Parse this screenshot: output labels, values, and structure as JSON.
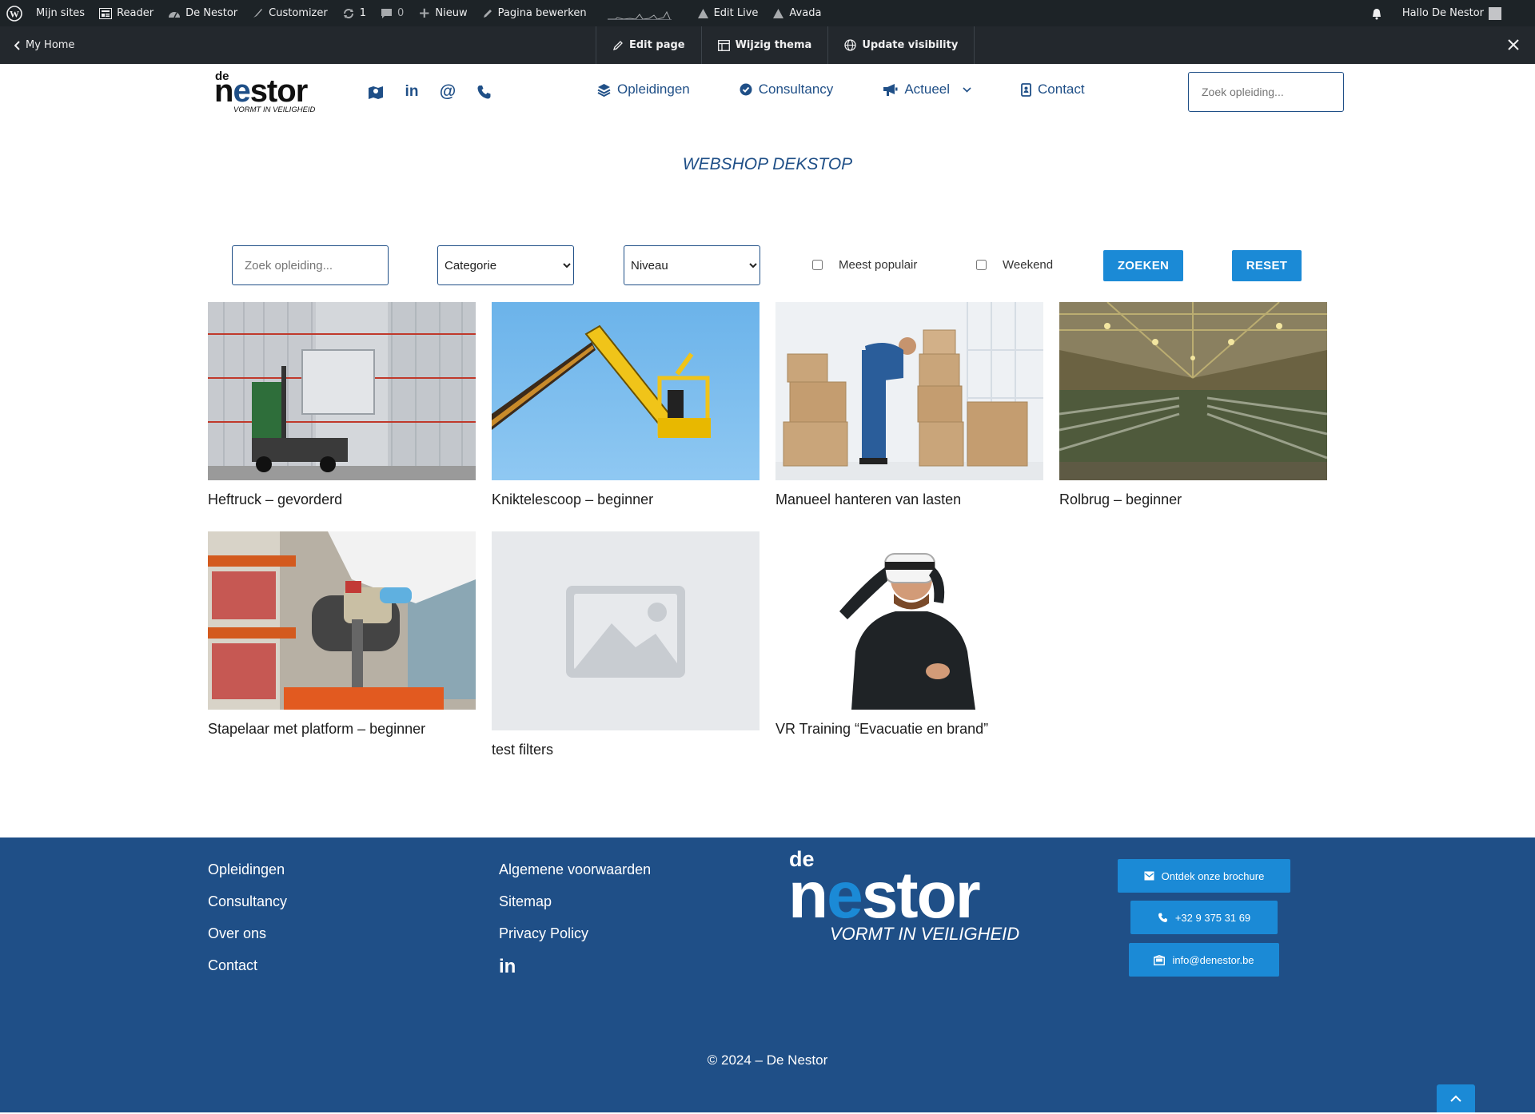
{
  "admin_bar": {
    "my_sites": "Mijn sites",
    "reader": "Reader",
    "site_name": "De Nestor",
    "customizer": "Customizer",
    "updates_count": "1",
    "comments_count": "0",
    "new": "Nieuw",
    "edit_page": "Pagina bewerken",
    "edit_live": "Edit Live",
    "avada": "Avada",
    "greeting": "Hallo De Nestor"
  },
  "editor_bar": {
    "back_label": "My Home",
    "edit_page": "Edit page",
    "change_theme": "Wijzig thema",
    "update_visibility": "Update visibility"
  },
  "header": {
    "logo": {
      "de": "de",
      "name_pre": "n",
      "name_e": "e",
      "name_post": "stor",
      "tagline": "VORMT IN VEILIGHEID"
    },
    "icons": [
      "map-icon",
      "linkedin-icon",
      "at-icon",
      "phone-icon"
    ],
    "nav": [
      {
        "label": "Opleidingen",
        "icon": "layers-icon"
      },
      {
        "label": "Consultancy",
        "icon": "check-circle-icon"
      },
      {
        "label": "Actueel",
        "icon": "megaphone-icon",
        "has_dropdown": true
      },
      {
        "label": "Contact",
        "icon": "address-book-icon"
      }
    ],
    "search_placeholder": "Zoek opleiding..."
  },
  "page": {
    "title": "WEBSHOP DEKSTOP"
  },
  "filters": {
    "search_placeholder": "Zoek opleiding...",
    "category_selected": "Categorie",
    "level_selected": "Niveau",
    "popular_label": "Meest populair",
    "weekend_label": "Weekend",
    "search_button": "ZOEKEN",
    "reset_button": "RESET"
  },
  "products": [
    {
      "title": "Heftruck – gevorderd"
    },
    {
      "title": "Kniktelescoop – beginner"
    },
    {
      "title": "Manueel hanteren van lasten"
    },
    {
      "title": "Rolbrug – beginner"
    },
    {
      "title": "Stapelaar met platform – beginner"
    },
    {
      "title": "test filters"
    },
    {
      "title": "VR Training “Evacuatie en brand”"
    }
  ],
  "footer": {
    "col1": [
      "Opleidingen",
      "Consultancy",
      "Over ons",
      "Contact"
    ],
    "col2": [
      "Algemene voorwaarden",
      "Sitemap",
      "Privacy Policy"
    ],
    "logo": {
      "de": "de",
      "name_pre": "n",
      "name_e": "e",
      "name_post": "stor",
      "tagline": "VORMT IN VEILIGHEID"
    },
    "cta_brochure": "Ontdek onze brochure",
    "cta_phone": "+32 9 375 31 69",
    "cta_email": "info@denestor.be",
    "copyright": "© 2024 – De Nestor"
  },
  "colors": {
    "brand_blue": "#1f4f87",
    "button_blue": "#1b8ad6",
    "admin_bar": "#1d2327"
  }
}
